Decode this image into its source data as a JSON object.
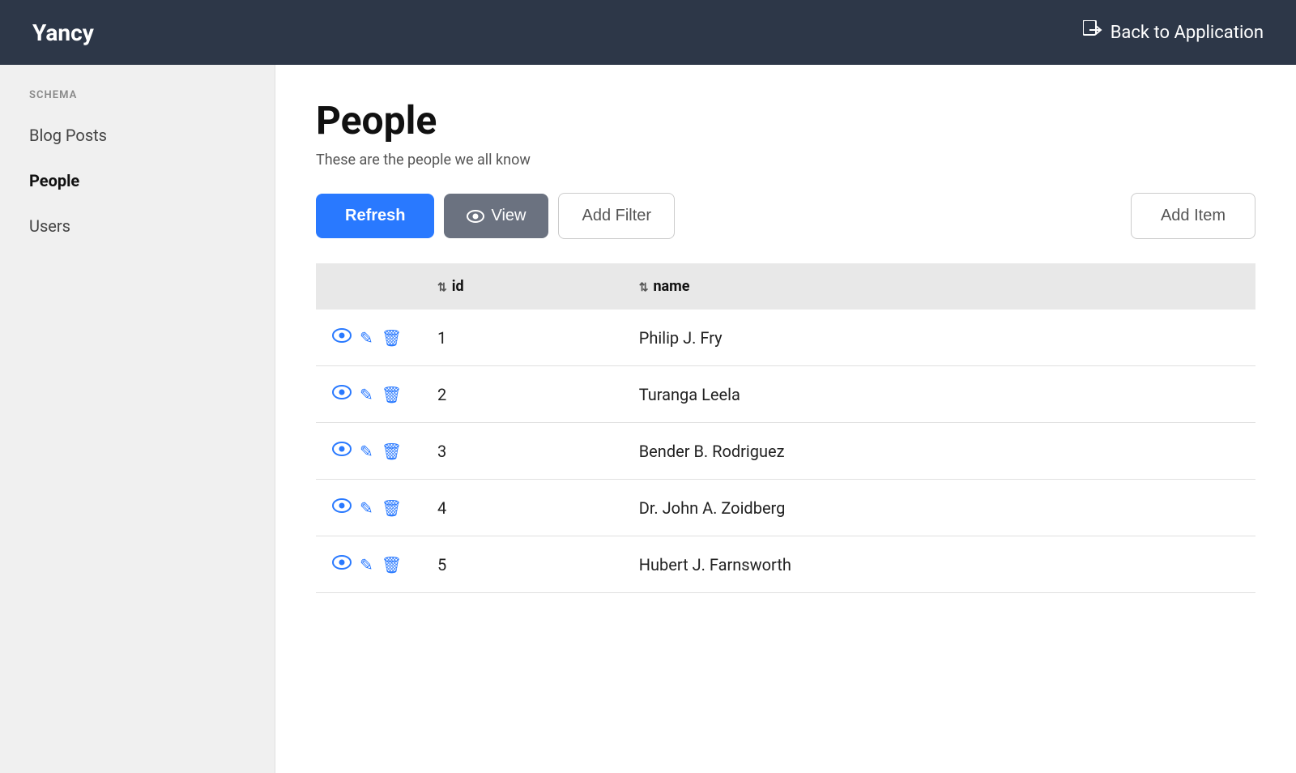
{
  "header": {
    "logo": "Yancy",
    "back_label": "Back to Application",
    "back_icon": "→"
  },
  "sidebar": {
    "schema_label": "SCHEMA",
    "items": [
      {
        "id": "blog-posts",
        "label": "Blog Posts",
        "active": false
      },
      {
        "id": "people",
        "label": "People",
        "active": true
      },
      {
        "id": "users",
        "label": "Users",
        "active": false
      }
    ]
  },
  "main": {
    "title": "People",
    "subtitle": "These are the people we all know",
    "toolbar": {
      "refresh_label": "Refresh",
      "view_label": "View",
      "add_filter_label": "Add Filter",
      "add_item_label": "Add Item"
    },
    "table": {
      "columns": [
        {
          "id": "actions",
          "label": ""
        },
        {
          "id": "id",
          "label": "id"
        },
        {
          "id": "name",
          "label": "name"
        }
      ],
      "rows": [
        {
          "id": 1,
          "name": "Philip J. Fry"
        },
        {
          "id": 2,
          "name": "Turanga Leela"
        },
        {
          "id": 3,
          "name": "Bender B. Rodriguez"
        },
        {
          "id": 4,
          "name": "Dr. John A. Zoidberg"
        },
        {
          "id": 5,
          "name": "Hubert J. Farnsworth"
        }
      ]
    }
  },
  "colors": {
    "header_bg": "#2d3748",
    "refresh_btn": "#2979ff",
    "view_btn": "#6b7280",
    "icon_blue": "#2979ff",
    "sidebar_bg": "#f0f0f0",
    "table_header_bg": "#e8e8e8"
  }
}
